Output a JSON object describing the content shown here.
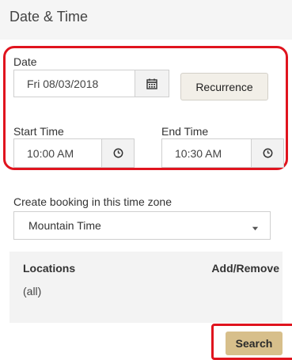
{
  "panel": {
    "title": "Date & Time"
  },
  "date": {
    "label": "Date",
    "value": "Fri 08/03/2018",
    "recurrence_label": "Recurrence"
  },
  "start_time": {
    "label": "Start Time",
    "value": "10:00 AM"
  },
  "end_time": {
    "label": "End Time",
    "value": "10:30 AM"
  },
  "timezone": {
    "label": "Create booking in this time zone",
    "value": "Mountain Time"
  },
  "locations": {
    "header": "Locations",
    "add_remove": "Add/Remove",
    "value": "(all)"
  },
  "search": {
    "label": "Search"
  },
  "icons": {
    "calendar": "calendar-icon",
    "clock": "clock-icon",
    "dropdown": "caret-down-icon"
  },
  "colors": {
    "highlight": "#e0141e",
    "search_button": "#d7bf8b",
    "panel_bg": "#f3f3f3"
  }
}
